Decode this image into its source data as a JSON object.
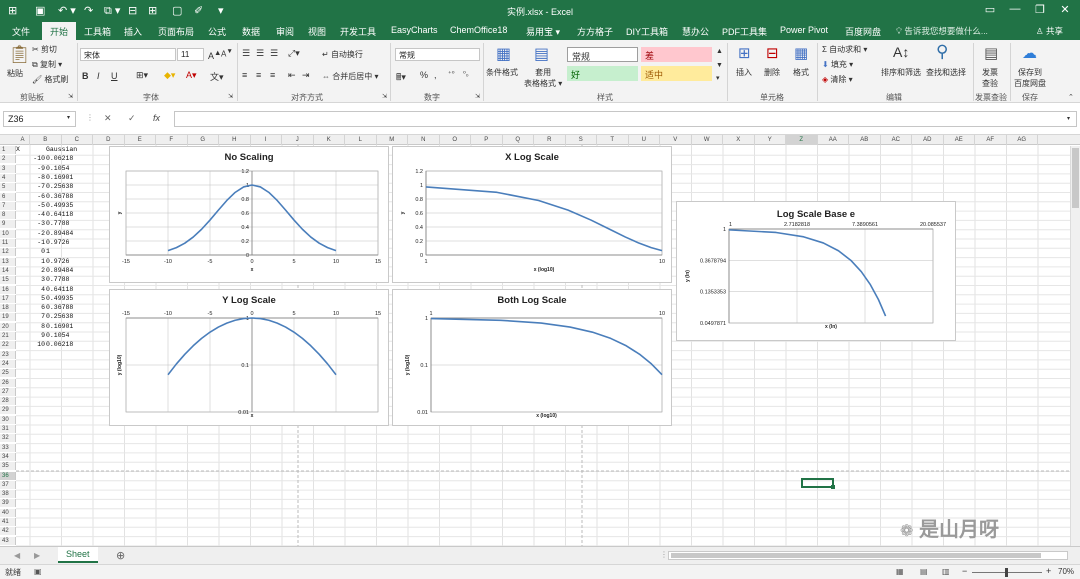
{
  "window": {
    "title": "实例.xlsx - Excel",
    "close": "✕",
    "maximize": "❐",
    "minimize": "—",
    "restore": "▭"
  },
  "ribbon_tabs": [
    "文件",
    "开始",
    "工具箱",
    "插入",
    "页面布局",
    "公式",
    "数据",
    "审阅",
    "视图",
    "开发工具",
    "EasyCharts",
    "ChemOffice18",
    "易用宝 ▾",
    "方方格子",
    "DIY工具箱",
    "慧办公",
    "PDF工具集",
    "Power Pivot",
    "百度网盘"
  ],
  "active_tab": "开始",
  "search_hint": "告诉我您想要做什么...",
  "share": "共享",
  "ribbon": {
    "paste": "粘贴",
    "cut": "剪切",
    "copy": "复制 ▾",
    "format_painter": "格式刷",
    "font_name": "宋体",
    "font_size": "11",
    "bold": "B",
    "italic": "I",
    "underline": "U",
    "wrap_text": "自动换行",
    "merge_center": "合并后居中 ▾",
    "number_format": "常规",
    "percent": "%",
    "comma": ",",
    "cond_format": "条件格式",
    "table_format": "套用\n表格格式 ▾",
    "style_normal": "常规",
    "style_bad": "差",
    "style_good": "好",
    "style_neutral": "适中",
    "insert": "插入",
    "delete": "删除",
    "format": "格式",
    "autosum": "Σ 自动求和 ▾",
    "fill": "填充 ▾",
    "clear": "清除 ▾",
    "sort_filter": "排序和筛选",
    "find_select": "查找和选择",
    "invoice_check": "发票\n查验",
    "save_baidu": "保存到\n百度网盘"
  },
  "groups": [
    "剪贴板",
    "字体",
    "对齐方式",
    "数字",
    "样式",
    "单元格",
    "编辑",
    "发票查验",
    "保存"
  ],
  "formula_bar": {
    "name_box": "Z36",
    "cancel": "✕",
    "enter": "✓",
    "fx": "fx",
    "formula": ""
  },
  "columns": [
    "A",
    "B",
    "C",
    "D",
    "E",
    "F",
    "G",
    "H",
    "I",
    "J",
    "K",
    "L",
    "M",
    "N",
    "O",
    "P",
    "Q",
    "R",
    "S",
    "T",
    "U",
    "V",
    "W",
    "X",
    "Y",
    "Z",
    "AA",
    "AB",
    "AC",
    "AD",
    "AE",
    "AF",
    "AG"
  ],
  "rows": [
    "1",
    "2",
    "3",
    "4",
    "5",
    "6",
    "7",
    "8",
    "9",
    "10",
    "11",
    "12",
    "13",
    "14",
    "15",
    "16",
    "17",
    "18",
    "19",
    "20",
    "21",
    "22",
    "23",
    "24",
    "25",
    "26",
    "27",
    "28",
    "29",
    "30",
    "31",
    "32",
    "33",
    "34",
    "35",
    "36",
    "37",
    "38",
    "39",
    "40",
    "41",
    "42",
    "43"
  ],
  "sheet_data": {
    "header_x": "X",
    "header_gauss": "Gaussian",
    "x": [
      "-10",
      "-9",
      "-8",
      "-7",
      "-6",
      "-5",
      "-4",
      "-3",
      "-2",
      "-1",
      "0",
      "1",
      "2",
      "3",
      "4",
      "5",
      "6",
      "7",
      "8",
      "9",
      "10"
    ],
    "g": [
      "0.06218",
      "0.1054",
      "0.16901",
      "0.25638",
      "0.36788",
      "0.49935",
      "0.64118",
      "0.7788",
      "0.89484",
      "0.9726",
      "1",
      "0.9726",
      "0.89484",
      "0.7788",
      "0.64118",
      "0.49935",
      "0.36788",
      "0.25638",
      "0.16901",
      "0.1054",
      "0.06218"
    ]
  },
  "chart_data": [
    {
      "type": "line",
      "title": "No Scaling",
      "xlabel": "x",
      "ylabel": "y",
      "xlim": [
        -15,
        15
      ],
      "ylim": [
        0,
        1.2
      ],
      "x": [
        -10,
        -9,
        -8,
        -7,
        -6,
        -5,
        -4,
        -3,
        -2,
        -1,
        0,
        1,
        2,
        3,
        4,
        5,
        6,
        7,
        8,
        9,
        10
      ],
      "values": [
        0.06218,
        0.1054,
        0.16901,
        0.25638,
        0.36788,
        0.49935,
        0.64118,
        0.7788,
        0.89484,
        0.9726,
        1,
        0.9726,
        0.89484,
        0.7788,
        0.64118,
        0.49935,
        0.36788,
        0.25638,
        0.16901,
        0.1054,
        0.06218
      ],
      "xticks": [
        "-15",
        "-10",
        "-5",
        "0",
        "5",
        "10",
        "15"
      ],
      "yticks": [
        "0",
        "0.2",
        "0.4",
        "0.6",
        "0.8",
        "1",
        "1.2"
      ],
      "grid": true
    },
    {
      "type": "line",
      "title": "X Log Scale",
      "xlabel": "x (log10)",
      "ylabel": "y",
      "xlim": [
        1,
        10
      ],
      "x_scale": "log10",
      "ylim": [
        0,
        1.2
      ],
      "x": [
        1,
        2,
        3,
        4,
        5,
        6,
        7,
        8,
        9,
        10
      ],
      "values": [
        0.9726,
        0.89484,
        0.7788,
        0.64118,
        0.49935,
        0.36788,
        0.25638,
        0.16901,
        0.1054,
        0.06218
      ],
      "xticks": [
        "1",
        "10"
      ],
      "yticks": [
        "0",
        "0.2",
        "0.4",
        "0.6",
        "0.8",
        "1",
        "1.2"
      ],
      "grid": true
    },
    {
      "type": "line",
      "title": "Y Log Scale",
      "xlabel": "x",
      "ylabel": "y (log10)",
      "xlim": [
        -15,
        15
      ],
      "ylim": [
        0.01,
        1
      ],
      "y_scale": "log10",
      "x": [
        -10,
        -9,
        -8,
        -7,
        -6,
        -5,
        -4,
        -3,
        -2,
        -1,
        0,
        1,
        2,
        3,
        4,
        5,
        6,
        7,
        8,
        9,
        10
      ],
      "values": [
        0.06218,
        0.1054,
        0.16901,
        0.25638,
        0.36788,
        0.49935,
        0.64118,
        0.7788,
        0.89484,
        0.9726,
        1,
        0.9726,
        0.89484,
        0.7788,
        0.64118,
        0.49935,
        0.36788,
        0.25638,
        0.16901,
        0.1054,
        0.06218
      ],
      "xticks": [
        "-15",
        "-10",
        "-5",
        "0",
        "5",
        "10",
        "15"
      ],
      "yticks": [
        "0.01",
        "0.1",
        "1"
      ],
      "grid": true
    },
    {
      "type": "line",
      "title": "Both Log Scale",
      "xlabel": "x (log10)",
      "ylabel": "y (log10)",
      "xlim": [
        1,
        10
      ],
      "x_scale": "log10",
      "ylim": [
        0.01,
        1
      ],
      "y_scale": "log10",
      "x": [
        1,
        2,
        3,
        4,
        5,
        6,
        7,
        8,
        9,
        10
      ],
      "values": [
        0.9726,
        0.89484,
        0.7788,
        0.64118,
        0.49935,
        0.36788,
        0.25638,
        0.16901,
        0.1054,
        0.06218
      ],
      "xticks": [
        "1",
        "10"
      ],
      "yticks": [
        "0.01",
        "0.1",
        "1"
      ],
      "grid": true
    },
    {
      "type": "line",
      "title": "Log Scale Base e",
      "xlabel": "x (ln)",
      "ylabel": "y (ln)",
      "xlim": [
        1,
        20.085537
      ],
      "x_scale": "ln",
      "ylim": [
        0.0497871,
        1
      ],
      "y_scale": "ln",
      "x": [
        1,
        2,
        3,
        4,
        5,
        6,
        7,
        8,
        9,
        10
      ],
      "values": [
        0.9726,
        0.89484,
        0.7788,
        0.64118,
        0.49935,
        0.36788,
        0.25638,
        0.16901,
        0.1054,
        0.06218
      ],
      "xticks": [
        "1",
        "2.7182818",
        "7.3890561",
        "20.085537"
      ],
      "yticks": [
        "0.0497871",
        "0.1353353",
        "0.3678794",
        "1"
      ],
      "grid": true
    }
  ],
  "sheet_tab": "Sheet",
  "add_sheet": "⊕",
  "status": {
    "ready": "就绪",
    "zoom": "70%",
    "minus": "−",
    "plus": "+"
  },
  "watermark": "是山月呀"
}
